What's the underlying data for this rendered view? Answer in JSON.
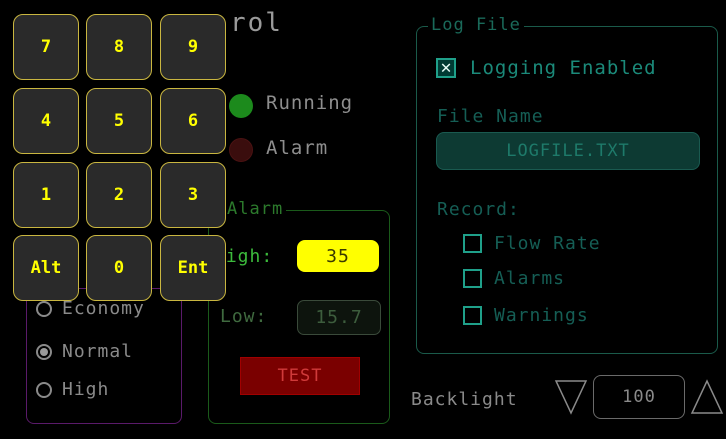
{
  "header": {
    "title_fragment": "rol"
  },
  "status": {
    "running_label": "Running",
    "alarm_label": "Alarm"
  },
  "alarm": {
    "title": "Alarm",
    "high_label": "High:",
    "high_value": "35",
    "low_label": "Low:",
    "low_value": "15.7",
    "test_label": "TEST"
  },
  "mode": {
    "options": [
      {
        "label": "Economy",
        "selected": false
      },
      {
        "label": "Normal",
        "selected": true
      },
      {
        "label": "High",
        "selected": false
      }
    ]
  },
  "log_file": {
    "title": "Log File",
    "logging_enabled_label": "Logging Enabled",
    "logging_enabled": true,
    "file_name_label": "File Name",
    "file_name_value": "LOGFILE.TXT",
    "record_label": "Record:",
    "record_items": [
      {
        "label": "Flow Rate",
        "checked": false
      },
      {
        "label": "Alarms",
        "checked": false
      },
      {
        "label": "Warnings",
        "checked": false
      }
    ]
  },
  "backlight": {
    "label": "Backlight",
    "value": "100",
    "decrease_icon": "triangle-down-icon",
    "increase_icon": "triangle-up-icon"
  },
  "keypad": {
    "keys": [
      "7",
      "8",
      "9",
      "4",
      "5",
      "6",
      "1",
      "2",
      "3",
      "Alt",
      "0",
      "Ent"
    ]
  },
  "colors": {
    "keypad_text": "#ffff00",
    "high_value_bg": "#ffff00",
    "running_led": "#1c8a1c",
    "test_button": "#7a0000",
    "log_teal": "#1b8a7a"
  }
}
